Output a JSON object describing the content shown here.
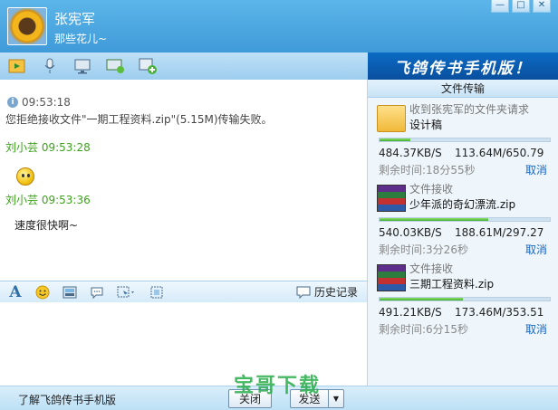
{
  "contact": {
    "name": "张宪军",
    "signature": "那些花儿~"
  },
  "window_buttons": [
    "—",
    "□",
    "✕"
  ],
  "toolbar_icons": [
    "send-file-icon",
    "voice-icon",
    "video-icon",
    "remote-desktop-icon",
    "add-app-icon"
  ],
  "banner": "飞鸽传书手机版！",
  "chat": {
    "system_time": "09:53:18",
    "system_message": "您拒绝接收文件\"一期工程资料.zip\"(5.15M)传输失败。",
    "messages": [
      {
        "sender": "刘小芸",
        "time": "09:53:28",
        "content": ""
      },
      {
        "sender": "刘小芸",
        "time": "09:53:36",
        "content": "速度很快啊~"
      }
    ]
  },
  "input_toolbar": {
    "history_label": "历史记录"
  },
  "bottom": {
    "learn_label": "了解飞鸽传书手机版",
    "close_label": "关闭",
    "send_label": "发送",
    "dropdown_label": "▼"
  },
  "watermark": "宝哥下载",
  "transfer_panel": {
    "title": "文件传输",
    "items": [
      {
        "type": "收到张宪军的文件夹请求",
        "name": "设计稿",
        "speed": "484.37KB/S",
        "size": "113.64M/650.79",
        "remain": "剩余时间:18分55秒",
        "cancel": "取消",
        "progress": 0.18,
        "icon": "folder-icon"
      },
      {
        "type": "文件接收",
        "name": "少年派的奇幻漂流.zip",
        "speed": "540.03KB/S",
        "size": "188.61M/297.27",
        "remain": "剩余时间:3分26秒",
        "cancel": "取消",
        "progress": 0.64,
        "icon": "zip-archive-icon"
      },
      {
        "type": "文件接收",
        "name": "三期工程资料.zip",
        "speed": "491.21KB/S",
        "size": "173.46M/353.51",
        "remain": "剩余时间:6分15秒",
        "cancel": "取消",
        "progress": 0.49,
        "icon": "zip-archive-icon"
      }
    ]
  }
}
